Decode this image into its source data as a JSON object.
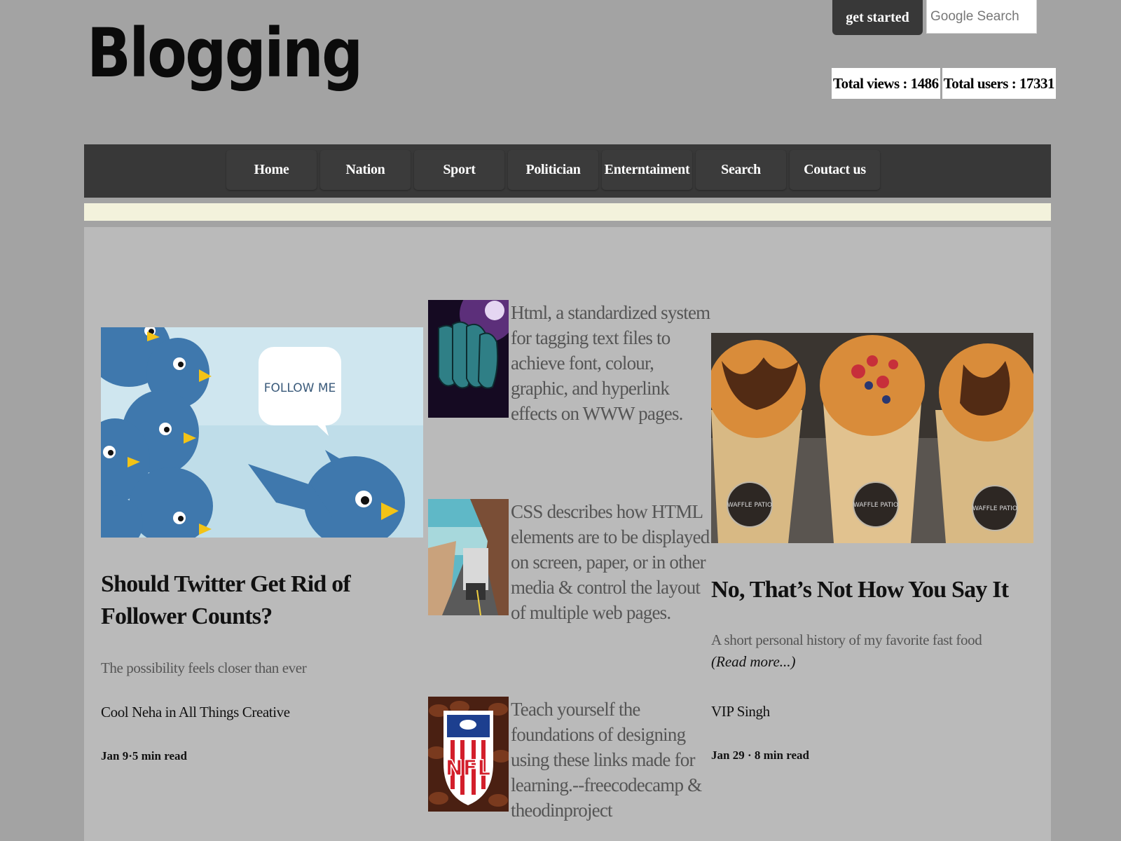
{
  "header": {
    "brand": "Blogging",
    "get_started_label": "get started",
    "search_placeholder": "Google Search",
    "total_views_label": "Total views : 1486",
    "total_users_label": "Total users : 17331"
  },
  "nav": {
    "items": [
      "Home",
      "Nation",
      "Sport",
      "Politician",
      "Enterntaiment",
      "Search",
      "Coutact us"
    ]
  },
  "left_card": {
    "image_text": "FOLLOW ME",
    "title": "Should Twitter Get Rid of Follower Counts?",
    "subtitle": "The possibility feels closer than ever",
    "author": "Cool Neha in All Things Creative",
    "meta": "Jan 9·5 min read"
  },
  "middle_items": [
    {
      "thumb": "masks-image",
      "text": "Html, a standardized system for tagging text files to achieve font, colour, graphic, and hyperlink effects on WWW pages."
    },
    {
      "thumb": "truck-road-image",
      "text": "CSS describes how HTML elements are to be displayed on screen, paper, or in other media & control the layout of multiple web pages."
    },
    {
      "thumb": "nfl-logo-image",
      "thumb_text": "NFL",
      "text": "Teach yourself the foundations of designing using these links made for learning.--freecodecamp & theodinproject"
    }
  ],
  "right_card": {
    "image_text": "WAFFLE PATIO",
    "title": "No, That’s Not How You Say It",
    "subtitle": "A short personal history of my favorite fast food",
    "read_more": "(Read more...)",
    "author": "VIP Singh",
    "meta": "Jan 29 · 8 min read"
  },
  "colors": {
    "page_bg": "#a3a3a3",
    "nav_bg": "#383838",
    "strip": "#f3f2dc",
    "content_bg": "#bababa"
  }
}
